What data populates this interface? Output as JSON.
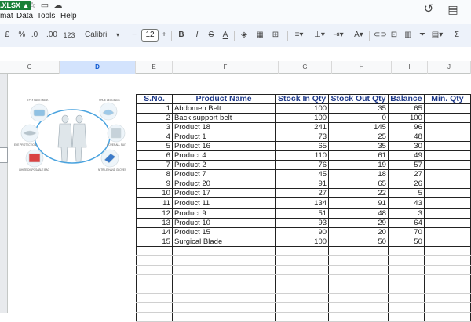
{
  "title_bar": {
    "file_badge": ".XLSX",
    "badge_icon": "warning-triangle-icon",
    "icons": [
      "star-icon",
      "folder-icon",
      "cloud-icon"
    ],
    "menus": [
      "mat",
      "Data",
      "Tools",
      "Help"
    ],
    "right_icons": [
      "history-icon",
      "comment-icon"
    ]
  },
  "toolbar": {
    "currency_fragment": "£",
    "percent": "%",
    "dec_decrease": ".0",
    "dec_increase": ".00",
    "number_format": "123",
    "font": "Calibri",
    "font_size": "12",
    "minus": "−",
    "plus": "+",
    "bold": "B",
    "italic": "I",
    "strike": "S",
    "text_color": "A"
  },
  "columns": [
    "C",
    "D",
    "E",
    "F",
    "G",
    "H",
    "I",
    "J"
  ],
  "selected_column": "D",
  "image_labels": [
    "3 PLY FACE MASK",
    "SHOE LEGGINGS",
    "EYE PROTECTION",
    "COVERALL SUIT",
    "WHITE DISPOSABLE BAG",
    "NITRILE HAND GLOVES"
  ],
  "table": {
    "headers": [
      "S.No.",
      "Product Name",
      "Stock In Qty",
      "Stock Out Qty",
      "Balance",
      "Min. Qty"
    ],
    "rows": [
      [
        "1",
        "Abdomen Belt",
        "100",
        "35",
        "65"
      ],
      [
        "2",
        "Back support belt",
        "100",
        "0",
        "100"
      ],
      [
        "3",
        "Product 18",
        "241",
        "145",
        "96"
      ],
      [
        "4",
        "Product 1",
        "73",
        "25",
        "48"
      ],
      [
        "5",
        "Product 16",
        "65",
        "35",
        "30"
      ],
      [
        "6",
        "Product 4",
        "110",
        "61",
        "49"
      ],
      [
        "7",
        "Product 2",
        "76",
        "19",
        "57"
      ],
      [
        "8",
        "Product 7",
        "45",
        "18",
        "27"
      ],
      [
        "9",
        "Product 20",
        "91",
        "65",
        "26"
      ],
      [
        "10",
        "Product 17",
        "27",
        "22",
        "5"
      ],
      [
        "11",
        "Product 11",
        "134",
        "91",
        "43"
      ],
      [
        "12",
        "Product 9",
        "51",
        "48",
        "3"
      ],
      [
        "13",
        "Product 10",
        "93",
        "29",
        "64"
      ],
      [
        "14",
        "Product 15",
        "90",
        "20",
        "70"
      ],
      [
        "15",
        "Surgical Blade",
        "100",
        "50",
        "50"
      ]
    ]
  }
}
